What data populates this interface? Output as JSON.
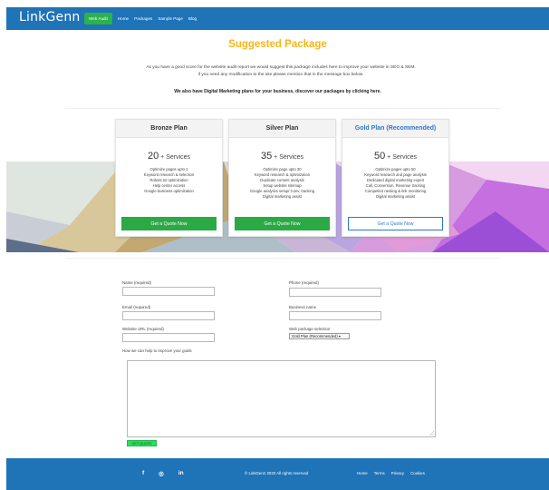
{
  "header": {
    "logo": "LinkGenn",
    "nav": [
      "Web Audit",
      "Home",
      "Packages",
      "Sample Page",
      "Blog"
    ]
  },
  "main": {
    "title": "Suggested Package",
    "intro_line1": "As you have a good score for the website audit report we would suggest this package includes here to improve your website in SEO & SEM.",
    "intro_line2": "if you need any modification to the site please mention that in the message box below.",
    "intro_bold": "We also have Digital Marketing plans for your business, discover our packages by clicking here."
  },
  "plans": [
    {
      "name": "Bronze Plan",
      "count": "20",
      "suffix": "+ Services",
      "features": [
        "Optimize pages upto 1",
        "Keyword research & selection",
        "Robots.txt optimization",
        "Help center access",
        "Google business optimization"
      ],
      "button": "Get a Quote Now"
    },
    {
      "name": "Silver Plan",
      "count": "35",
      "suffix": "+ Services",
      "features": [
        "Optimize page upto 30",
        "Keyword research & optimization",
        "Duplicate content analysis",
        "Setup website sitemap",
        "Google analytics setup/ Conv. tracking",
        "Digital marketing assist"
      ],
      "button": "Get a Quote Now"
    },
    {
      "name": "Gold Plan (Recommended)",
      "count": "50",
      "suffix": "+ Services",
      "features": [
        "Optimize pages upto 50",
        "Keyword research and page analysis",
        "Dedicated digital marketing expert",
        "Call, Conversion, Revenue tracking",
        "Competitor ranking & link monitoring",
        "Digital marketing assist"
      ],
      "button": "Get a Quote Now"
    }
  ],
  "form": {
    "name_label": "Name (required)",
    "phone_label": "Phone (required)",
    "email_label": "Email (required)",
    "business_label": "Business name",
    "url_label": "Website URL (required)",
    "package_label": "Web package selection",
    "package_selected": "Gold Plan (Recommended)",
    "message_label": "How we can help to improve your goals",
    "submit_label": "GET QUOTE"
  },
  "footer": {
    "social": [
      "f",
      "◎",
      "in"
    ],
    "copyright": "© LinkGenn 2020 All rights reserved",
    "links": [
      "Home",
      "Terms",
      "Privacy",
      "Cookies"
    ]
  },
  "colors": {
    "brand_blue": "#1f73b7",
    "accent_yellow": "#f7b515",
    "button_green": "#2ba945",
    "link_blue": "#2a79c7"
  }
}
